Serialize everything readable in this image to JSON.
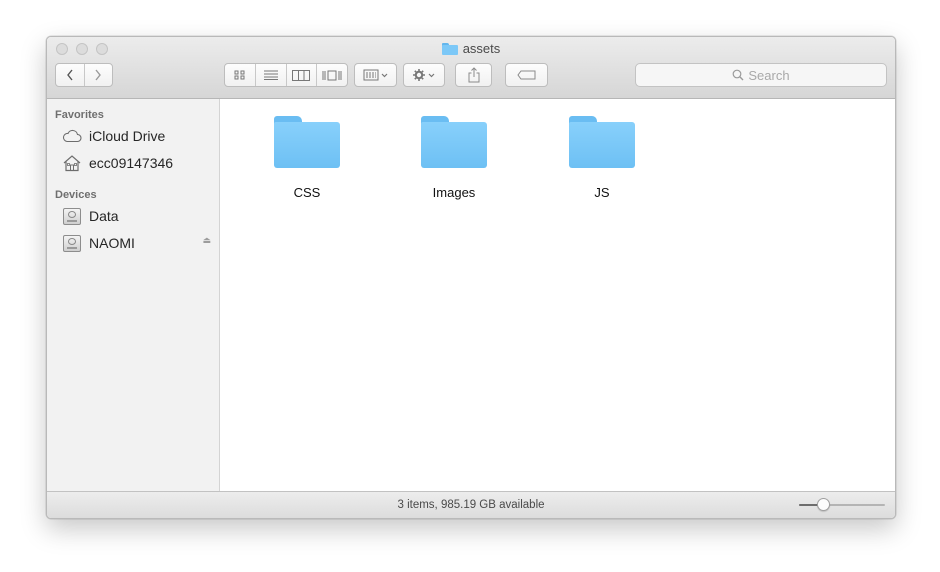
{
  "window": {
    "title": "assets"
  },
  "toolbar": {
    "search_placeholder": "Search",
    "icons": {
      "back": "chevron-left-icon",
      "forward": "chevron-right-icon",
      "icon_view": "grid-icon",
      "list_view": "list-icon",
      "column_view": "columns-icon",
      "cover_flow_view": "coverflow-icon",
      "arrange": "arrange-icon",
      "action": "gear-icon",
      "share": "share-icon",
      "tags": "tag-icon"
    }
  },
  "sidebar": {
    "favorites_header": "Favorites",
    "favorites": [
      {
        "label": "iCloud Drive",
        "icon": "cloud-icon"
      },
      {
        "label": "ecc09147346",
        "icon": "home-icon"
      }
    ],
    "devices_header": "Devices",
    "devices": [
      {
        "label": "Data",
        "icon": "disk-icon"
      },
      {
        "label": "NAOMI",
        "icon": "disk-icon",
        "eject_icon": "eject-icon"
      }
    ]
  },
  "content": {
    "items": [
      {
        "name": "CSS",
        "type": "folder"
      },
      {
        "name": "Images",
        "type": "folder"
      },
      {
        "name": "JS",
        "type": "folder"
      }
    ]
  },
  "statusbar": {
    "text": "3 items, 985.19 GB available",
    "icon_size_slider": 0.25
  },
  "colors": {
    "folder": "#7cc8f7",
    "sidebar_bg": "#f2f2f2",
    "toolbar_bg": "#e1e1e1"
  }
}
